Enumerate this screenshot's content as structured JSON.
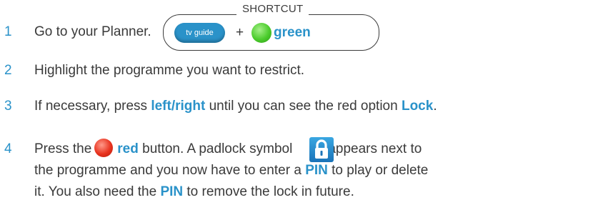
{
  "shortcut": {
    "title": "SHORTCUT",
    "tv_guide_button": "tv guide",
    "plus": "+",
    "green_button": "green"
  },
  "steps": [
    {
      "number": "1",
      "text": "Go to your Planner."
    },
    {
      "number": "2",
      "text": "Highlight the programme you want to restrict."
    },
    {
      "number": "3",
      "pre": "If necessary, press ",
      "key": "left/right",
      "mid": " until you can see the red option ",
      "option": "Lock",
      "post": "."
    },
    {
      "number": "4",
      "line1_pre": "Press the",
      "line1_key": "red",
      "line1_mid": "button. A padlock symbol",
      "line1_post": "appears next to",
      "line2_pre": "the programme and you now have to enter a ",
      "line2_key": "PIN",
      "line2_post": " to play or delete",
      "line3_pre": "it. You also need the ",
      "line3_key": "PIN",
      "line3_post": " to remove the lock in future."
    }
  ],
  "colors": {
    "accent_blue": "#2a92c9",
    "body_text": "#3a3a3a",
    "green_button": "#4bcc2c",
    "red_button": "#e8321e"
  }
}
